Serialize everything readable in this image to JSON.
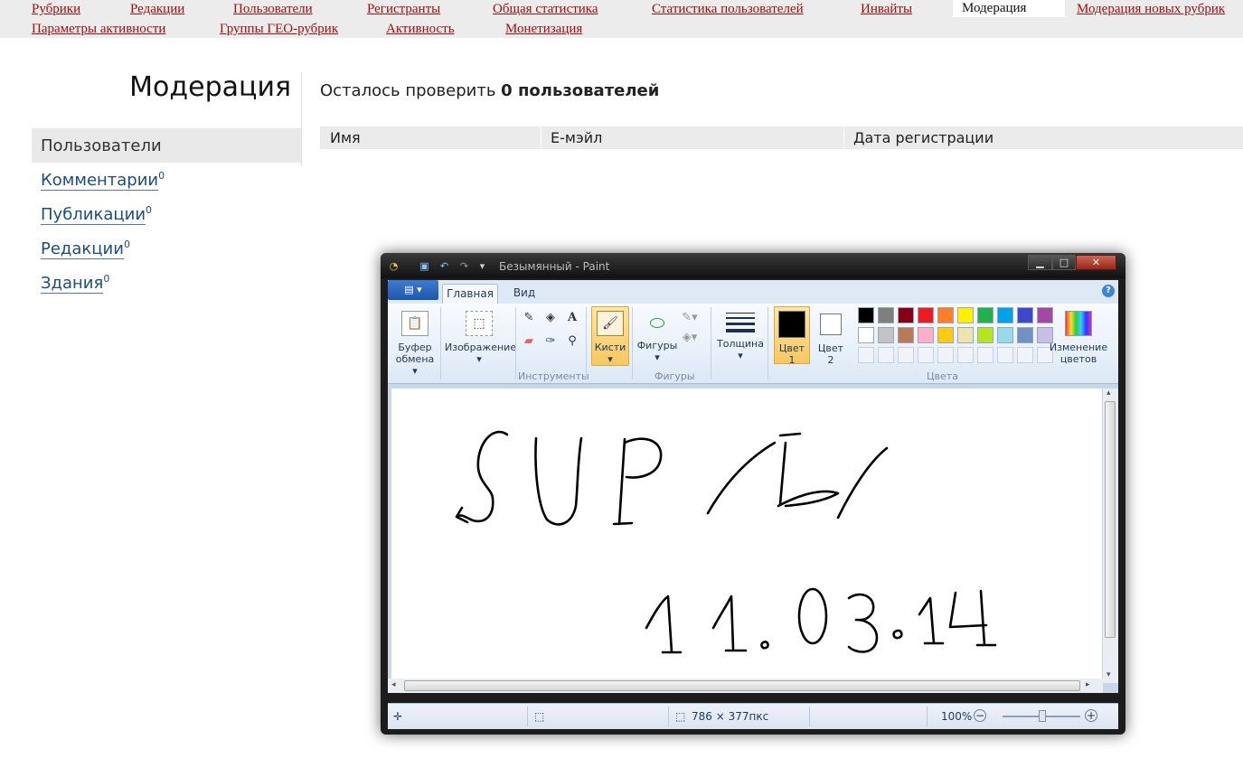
{
  "nav": {
    "row1": [
      "Рубрики",
      "Редакции",
      "Пользователи",
      "Регистранты",
      "Общая статистика",
      "Статистика пользователей",
      "Инвайты"
    ],
    "active": "Модерация",
    "row1_after": "Модерация новых рубрик",
    "row2": [
      "Параметры активности",
      "Группы ГЕО-рубрик",
      "Активность",
      "Монетизация"
    ]
  },
  "page": {
    "title": "Модерация",
    "remaining_prefix": "Осталось проверить",
    "remaining_count": "0 пользователей"
  },
  "sidebar": {
    "active": "Пользователи",
    "items": [
      {
        "label": "Комментарии",
        "count": "0"
      },
      {
        "label": "Публикации",
        "count": "0"
      },
      {
        "label": "Редакции",
        "count": "0"
      },
      {
        "label": "Здания",
        "count": "0"
      }
    ]
  },
  "table": {
    "headers": [
      "Имя",
      "Е-мэйл",
      "Дата регистрации"
    ]
  },
  "paint": {
    "title": "Безымянный - Paint",
    "tabs": {
      "home": "Главная",
      "view": "Вид"
    },
    "groups": {
      "clipboard_l1": "Буфер",
      "clipboard_l2": "обмена",
      "image": "Изображение",
      "tools": "Инструменты",
      "brushes": "Кисти",
      "shapes_btn": "Фигуры",
      "shapes": "Фигуры",
      "thickness": "Толщина",
      "color1_l1": "Цвет",
      "color1_l2": "1",
      "color2_l1": "Цвет",
      "color2_l2": "2",
      "colors": "Цвета",
      "edit_colors_l1": "Изменение",
      "edit_colors_l2": "цветов"
    },
    "palette_row1": [
      "#000000",
      "#7f7f7f",
      "#880015",
      "#ed1c24",
      "#ff7f27",
      "#fff200",
      "#22b14c",
      "#00a2e8",
      "#3f48cc",
      "#a349a4"
    ],
    "palette_row2": [
      "#ffffff",
      "#c3c3c3",
      "#b97a57",
      "#ffaec9",
      "#ffc90e",
      "#efe4b0",
      "#b5e61d",
      "#99d9ea",
      "#7092be",
      "#c8bfe7"
    ],
    "color1": "#000000",
    "color2": "#ffffff",
    "status": {
      "size": "786 × 377пкс",
      "zoom": "100%"
    }
  }
}
